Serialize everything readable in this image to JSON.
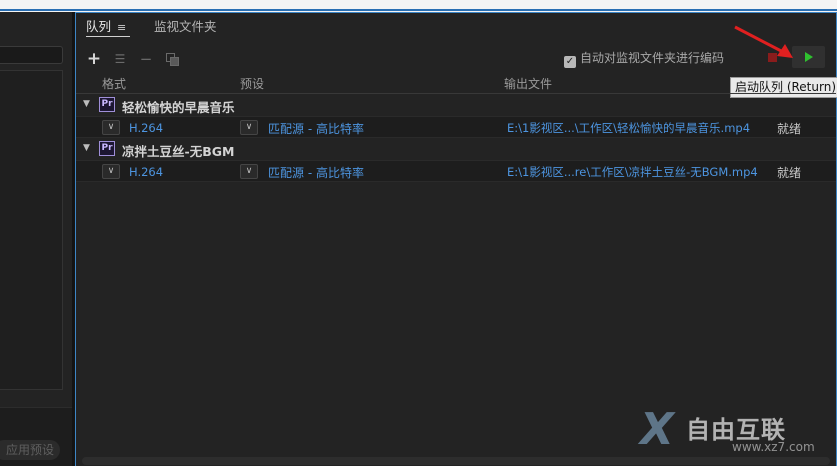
{
  "left_panel": {
    "apply_preset_label": "应用预设"
  },
  "tabs": {
    "queue": "队列",
    "queue_menu": "≡",
    "watch_folders": "监视文件夹"
  },
  "toolbar": {
    "add_icon": "plus-icon",
    "auto_encode_label": "自动对监视文件夹进行编码",
    "auto_encode_checked": true
  },
  "start_queue_tooltip": "启动队列 (Return)",
  "columns": {
    "format": "格式",
    "preset": "预设",
    "output": "输出文件"
  },
  "groups": [
    {
      "name": "轻松愉快的早晨音乐",
      "icon_label": "Pr",
      "item": {
        "format": "H.264",
        "preset": "匹配源 - 高比特率",
        "output": "E:\\1影视区...\\工作区\\轻松愉快的早晨音乐.mp4",
        "status": "就绪"
      }
    },
    {
      "name": "凉拌土豆丝-无BGM",
      "icon_label": "Pr",
      "item": {
        "format": "H.264",
        "preset": "匹配源 - 高比特率",
        "output": "E:\\1影视区...re\\工作区\\凉拌土豆丝-无BGM.mp4",
        "status": "就绪"
      }
    }
  ],
  "watermark": {
    "brand": "自由互联",
    "url": "www.xz7.com"
  },
  "colors": {
    "accent_blue": "#4d95e0",
    "start_green": "#2fc12f",
    "stop_red": "#8a1c1c",
    "arrow_red": "#e02020"
  }
}
